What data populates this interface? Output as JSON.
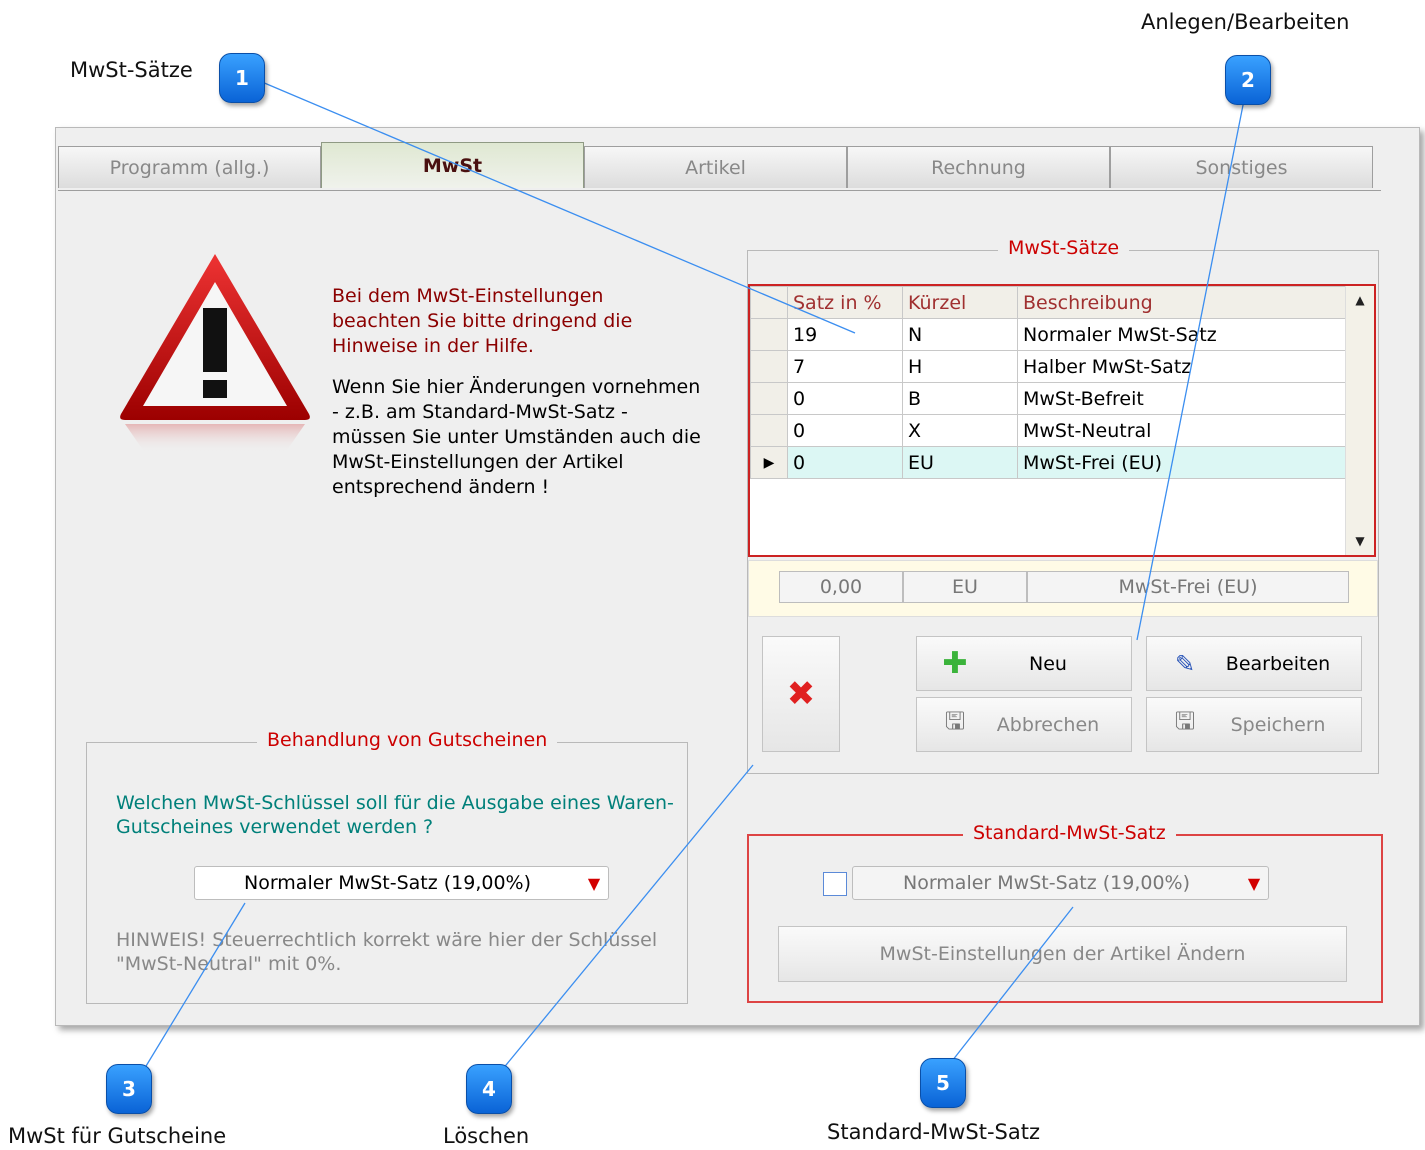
{
  "callouts": [
    {
      "num": "1",
      "label": "MwSt-Sätze"
    },
    {
      "num": "2",
      "label": "Anlegen/Bearbeiten"
    },
    {
      "num": "3",
      "label": "MwSt für Gutscheine"
    },
    {
      "num": "4",
      "label": "Löschen"
    },
    {
      "num": "5",
      "label": "Standard-MwSt-Satz"
    }
  ],
  "tabs": [
    "Programm (allg.)",
    "MwSt",
    "Artikel",
    "Rechnung",
    "Sonstiges"
  ],
  "warning": {
    "text_red_1": "Bei dem MwSt-Einstellungen",
    "text_red_2": "beachten Sie bitte dringend die",
    "text_red_3": "Hinweise in der Hilfe.",
    "text_1": "Wenn Sie hier Änderungen vornehmen",
    "text_2": "- z.B. am Standard-MwSt-Satz -",
    "text_3": "müssen Sie unter Umständen auch die",
    "text_4": "MwSt-Einstellungen der Artikel",
    "text_5": "entsprechend ändern !"
  },
  "rates_group": {
    "title": "MwSt-Sätze",
    "columns": [
      "Satz in %",
      "Kürzel",
      "Beschreibung"
    ],
    "rows": [
      [
        "19",
        "N",
        "Normaler MwSt-Satz"
      ],
      [
        "7",
        "H",
        "Halber MwSt-Satz"
      ],
      [
        "0",
        "B",
        "MwSt-Befreit"
      ],
      [
        "0",
        "X",
        "MwSt-Neutral"
      ],
      [
        "0",
        "EU",
        "MwSt-Frei (EU)"
      ]
    ],
    "selected_marker": "▶",
    "edit_rate": "0,00",
    "edit_code": "EU",
    "edit_desc": "MwSt-Frei (EU)",
    "delete_icon": "✖",
    "new_label": "Neu",
    "edit_label": "Bearbeiten",
    "cancel_label": "Abbrechen",
    "save_label": "Speichern"
  },
  "voucher_group": {
    "title": "Behandlung von Gutscheinen",
    "question_1": "Welchen MwSt-Schlüssel soll für die Ausgabe eines Waren-",
    "question_2": "Gutscheines verwendet werden ?",
    "selected": "Normaler MwSt-Satz (19,00%)",
    "hint_1": "HINWEIS! Steuerrechtlich korrekt wäre hier der Schlüssel",
    "hint_2": "\"MwSt-Neutral\" mit 0%."
  },
  "standard_group": {
    "title": "Standard-MwSt-Satz",
    "selected": "Normaler MwSt-Satz (19,00%)",
    "apply_button": "MwSt-Einstellungen der Artikel Ändern"
  },
  "colors": {
    "accent_red": "#cc0000",
    "teal_text": "#00807a",
    "bubble_blue": "#1a7ff0"
  }
}
